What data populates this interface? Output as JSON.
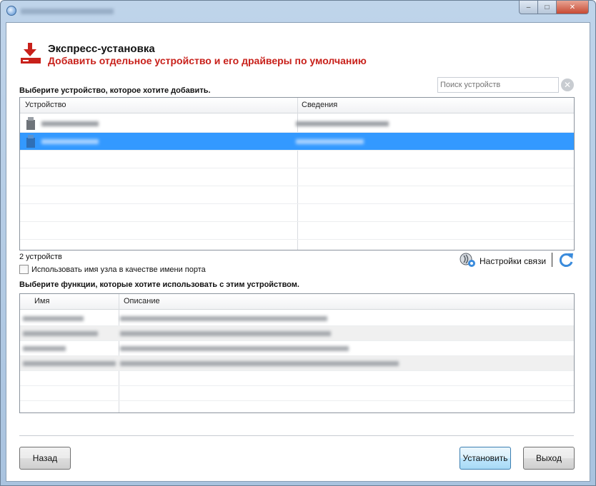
{
  "window": {
    "title": "",
    "controls": {
      "minimize": "–",
      "maximize": "□",
      "close": "✕"
    }
  },
  "header": {
    "title": "Экспресс-установка",
    "subtitle": "Добавить отдельное устройство и его драйверы по умолчанию",
    "accent_color": "#c8211b"
  },
  "search": {
    "placeholder": "Поиск устройств",
    "clear_glyph": "✕"
  },
  "devices": {
    "section_label": "Выберите устройство, которое хотите добавить.",
    "columns": [
      "Устройство",
      "Сведения"
    ],
    "rows": [
      {
        "icon": "printer-icon",
        "selected": false
      },
      {
        "icon": "printer-icon",
        "selected": true
      }
    ],
    "count_label": "2 устройств",
    "selection_color": "#3399ff"
  },
  "options": {
    "use_hostname_label": "Использовать имя узла в качестве имени порта",
    "use_hostname_checked": false,
    "connection_settings_label": "Настройки связи"
  },
  "features": {
    "section_label": "Выберите функции, которые хотите использовать с этим устройством.",
    "columns": [
      "Имя",
      "Описание"
    ]
  },
  "buttons": {
    "back": "Назад",
    "install": "Установить",
    "exit": "Выход"
  }
}
